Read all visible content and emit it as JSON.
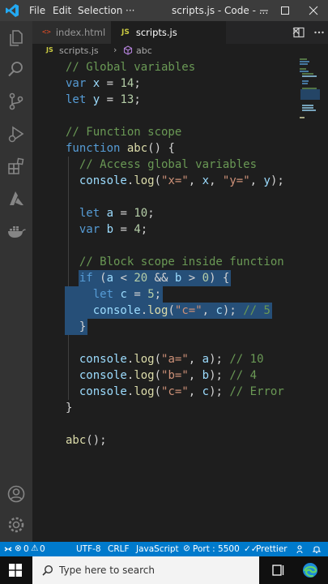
{
  "titlebar": {
    "menu": [
      "File",
      "Edit",
      "Selection",
      "···"
    ],
    "title": "scripts.js - Code - ..."
  },
  "tabs": [
    {
      "badge": "<>",
      "label": "index.html",
      "active": false
    },
    {
      "badge": "JS",
      "label": "scripts.js",
      "active": true
    }
  ],
  "breadcrumb": {
    "badge": "JS",
    "file": "scripts.js",
    "separator": "›",
    "symbol": "abc"
  },
  "code": {
    "lines": [
      [
        [
          "cm",
          "// Global variables"
        ]
      ],
      [
        [
          "kw",
          "var"
        ],
        [
          "pl",
          " "
        ],
        [
          "var",
          "x"
        ],
        [
          "pl",
          " = "
        ],
        [
          "num",
          "14"
        ],
        [
          "pl",
          ";"
        ]
      ],
      [
        [
          "kw",
          "let"
        ],
        [
          "pl",
          " "
        ],
        [
          "var",
          "y"
        ],
        [
          "pl",
          " = "
        ],
        [
          "num",
          "13"
        ],
        [
          "pl",
          ";"
        ]
      ],
      [],
      [
        [
          "cm",
          "// Function scope"
        ]
      ],
      [
        [
          "kw",
          "function"
        ],
        [
          "pl",
          " "
        ],
        [
          "fn",
          "abc"
        ],
        [
          "pl",
          "() {"
        ]
      ],
      [
        [
          "pl",
          "  "
        ],
        [
          "cm",
          "// Access global variables"
        ]
      ],
      [
        [
          "pl",
          "  "
        ],
        [
          "var",
          "console"
        ],
        [
          "pl",
          "."
        ],
        [
          "fn",
          "log"
        ],
        [
          "pl",
          "("
        ],
        [
          "str",
          "\"x=\""
        ],
        [
          "pl",
          ", "
        ],
        [
          "var",
          "x"
        ],
        [
          "pl",
          ", "
        ],
        [
          "str",
          "\"y=\""
        ],
        [
          "pl",
          ", "
        ],
        [
          "var",
          "y"
        ],
        [
          "pl",
          ");"
        ]
      ],
      [],
      [
        [
          "pl",
          "  "
        ],
        [
          "kw",
          "let"
        ],
        [
          "pl",
          " "
        ],
        [
          "var",
          "a"
        ],
        [
          "pl",
          " = "
        ],
        [
          "num",
          "10"
        ],
        [
          "pl",
          ";"
        ]
      ],
      [
        [
          "pl",
          "  "
        ],
        [
          "kw",
          "var"
        ],
        [
          "pl",
          " "
        ],
        [
          "var",
          "b"
        ],
        [
          "pl",
          " = "
        ],
        [
          "num",
          "4"
        ],
        [
          "pl",
          ";"
        ]
      ],
      [],
      [
        [
          "pl",
          "  "
        ],
        [
          "cm",
          "// Block scope inside function"
        ]
      ],
      [
        [
          "pl",
          "  "
        ],
        [
          "kw",
          "if"
        ],
        [
          "pl",
          " ("
        ],
        [
          "var",
          "a"
        ],
        [
          "pl",
          " < "
        ],
        [
          "num",
          "20"
        ],
        [
          "pl",
          " && "
        ],
        [
          "var",
          "b"
        ],
        [
          "pl",
          " > "
        ],
        [
          "num",
          "0"
        ],
        [
          "pl",
          ") {"
        ]
      ],
      [
        [
          "pl",
          "    "
        ],
        [
          "kw",
          "let"
        ],
        [
          "pl",
          " "
        ],
        [
          "var",
          "c"
        ],
        [
          "pl",
          " = "
        ],
        [
          "num",
          "5"
        ],
        [
          "pl",
          ";"
        ]
      ],
      [
        [
          "pl",
          "    "
        ],
        [
          "var",
          "console"
        ],
        [
          "pl",
          "."
        ],
        [
          "fn",
          "log"
        ],
        [
          "pl",
          "("
        ],
        [
          "str",
          "\"c=\""
        ],
        [
          "pl",
          ", "
        ],
        [
          "var",
          "c"
        ],
        [
          "pl",
          "); "
        ],
        [
          "cm",
          "// 5"
        ]
      ],
      [
        [
          "pl",
          "  }"
        ]
      ],
      [],
      [
        [
          "pl",
          "  "
        ],
        [
          "var",
          "console"
        ],
        [
          "pl",
          "."
        ],
        [
          "fn",
          "log"
        ],
        [
          "pl",
          "("
        ],
        [
          "str",
          "\"a=\""
        ],
        [
          "pl",
          ", "
        ],
        [
          "var",
          "a"
        ],
        [
          "pl",
          "); "
        ],
        [
          "cm",
          "// 10"
        ]
      ],
      [
        [
          "pl",
          "  "
        ],
        [
          "var",
          "console"
        ],
        [
          "pl",
          "."
        ],
        [
          "fn",
          "log"
        ],
        [
          "pl",
          "("
        ],
        [
          "str",
          "\"b=\""
        ],
        [
          "pl",
          ", "
        ],
        [
          "var",
          "b"
        ],
        [
          "pl",
          "); "
        ],
        [
          "cm",
          "// 4"
        ]
      ],
      [
        [
          "pl",
          "  "
        ],
        [
          "var",
          "console"
        ],
        [
          "pl",
          "."
        ],
        [
          "fn",
          "log"
        ],
        [
          "pl",
          "("
        ],
        [
          "str",
          "\"c=\""
        ],
        [
          "pl",
          ", "
        ],
        [
          "var",
          "c"
        ],
        [
          "pl",
          "); "
        ],
        [
          "cm",
          "// Error"
        ]
      ],
      [
        [
          "pl",
          "}"
        ]
      ],
      [],
      [
        [
          "fn",
          "abc"
        ],
        [
          "pl",
          "();"
        ]
      ]
    ],
    "selected_lines": [
      13,
      14,
      15,
      16
    ]
  },
  "statusbar": {
    "errors": "0",
    "warnings": "0",
    "encoding": "UTF-8",
    "eol": "CRLF",
    "language": "JavaScript",
    "port": "Port : 5500",
    "formatter": "Prettier"
  },
  "taskbar": {
    "search_placeholder": "Type here to search"
  },
  "colors": {
    "accent": "#007acc",
    "selection": "#264f78"
  }
}
